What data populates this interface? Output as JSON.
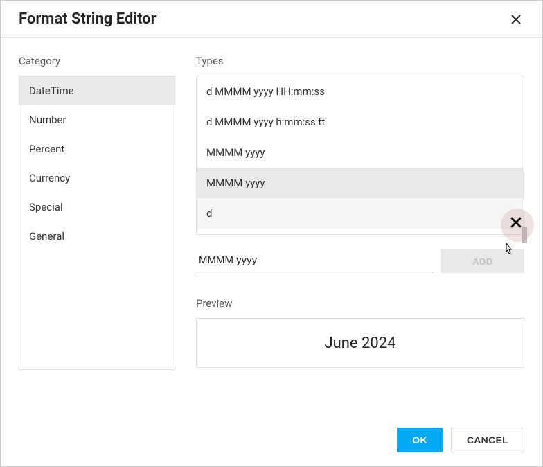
{
  "dialog": {
    "title": "Format String Editor"
  },
  "category": {
    "label": "Category",
    "items": [
      {
        "label": "DateTime",
        "selected": true
      },
      {
        "label": "Number",
        "selected": false
      },
      {
        "label": "Percent",
        "selected": false
      },
      {
        "label": "Currency",
        "selected": false
      },
      {
        "label": "Special",
        "selected": false
      },
      {
        "label": "General",
        "selected": false
      }
    ]
  },
  "types": {
    "label": "Types",
    "items": [
      {
        "label": "d MMMM yyyy HH:mm:ss",
        "selected": false,
        "hover": false
      },
      {
        "label": "d MMMM yyyy h:mm:ss tt",
        "selected": false,
        "hover": false
      },
      {
        "label": "MMMM yyyy",
        "selected": false,
        "hover": false
      },
      {
        "label": "MMMM yyyy",
        "selected": true,
        "hover": false
      },
      {
        "label": "d",
        "selected": false,
        "hover": true
      }
    ],
    "input_value": "MMMM yyyy",
    "add_label": "ADD"
  },
  "preview": {
    "label": "Preview",
    "value": "June 2024"
  },
  "footer": {
    "ok_label": "OK",
    "cancel_label": "CANCEL"
  }
}
